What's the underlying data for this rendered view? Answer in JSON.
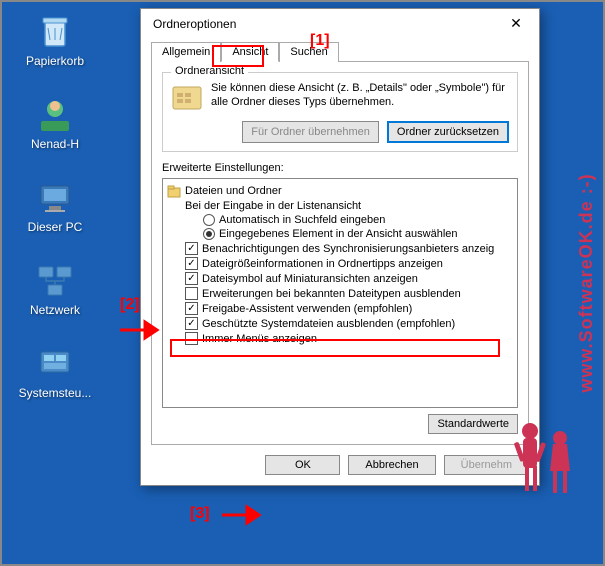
{
  "desktop": {
    "icons": [
      {
        "label": "Papierkorb"
      },
      {
        "label": "Nenad-H"
      },
      {
        "label": "Dieser PC"
      },
      {
        "label": "Netzwerk"
      },
      {
        "label": "Systemsteu..."
      }
    ]
  },
  "dialog": {
    "title": "Ordneroptionen",
    "tabs": {
      "general": "Allgemein",
      "view": "Ansicht",
      "search": "Suchen"
    },
    "folder_view": {
      "title": "Ordneransicht",
      "text": "Sie können diese Ansicht (z. B. „Details\" oder „Symbole\") für alle Ordner dieses Typs übernehmen.",
      "apply_btn": "Für Ordner übernehmen",
      "reset_btn": "Ordner zurücksetzen"
    },
    "advanced": {
      "label": "Erweiterte Einstellungen:",
      "folder_label": "Dateien und Ordner",
      "items": [
        {
          "text": "Bei der Eingabe in der Listenansicht",
          "type": "label",
          "lvl": 1
        },
        {
          "text": "Automatisch in Suchfeld eingeben",
          "type": "radio",
          "checked": false,
          "lvl": 2
        },
        {
          "text": "Eingegebenes Element in der Ansicht auswählen",
          "type": "radio",
          "checked": true,
          "lvl": 2
        },
        {
          "text": "Benachrichtigungen des Synchronisierungsanbieters anzeig",
          "type": "check",
          "checked": true,
          "lvl": 1
        },
        {
          "text": "Dateigrößeinformationen in Ordnertipps anzeigen",
          "type": "check",
          "checked": true,
          "lvl": 1
        },
        {
          "text": "Dateisymbol auf Miniaturansichten anzeigen",
          "type": "check",
          "checked": true,
          "lvl": 1
        },
        {
          "text": "Erweiterungen bei bekannten Dateitypen ausblenden",
          "type": "check",
          "checked": false,
          "lvl": 1
        },
        {
          "text": "Freigabe-Assistent verwenden (empfohlen)",
          "type": "check",
          "checked": true,
          "lvl": 1
        },
        {
          "text": "Geschützte Systemdateien ausblenden (empfohlen)",
          "type": "check",
          "checked": true,
          "lvl": 1
        },
        {
          "text": "Immer Menüs anzeigen",
          "type": "check",
          "checked": false,
          "lvl": 1
        }
      ],
      "defaults_btn": "Standardwerte"
    },
    "buttons": {
      "ok": "OK",
      "cancel": "Abbrechen",
      "apply": "Übernehm"
    }
  },
  "annotations": {
    "a1": "[1]",
    "a2": "[2]",
    "a3": "[3]"
  },
  "watermark": "www.SoftwareOK.de :-)"
}
